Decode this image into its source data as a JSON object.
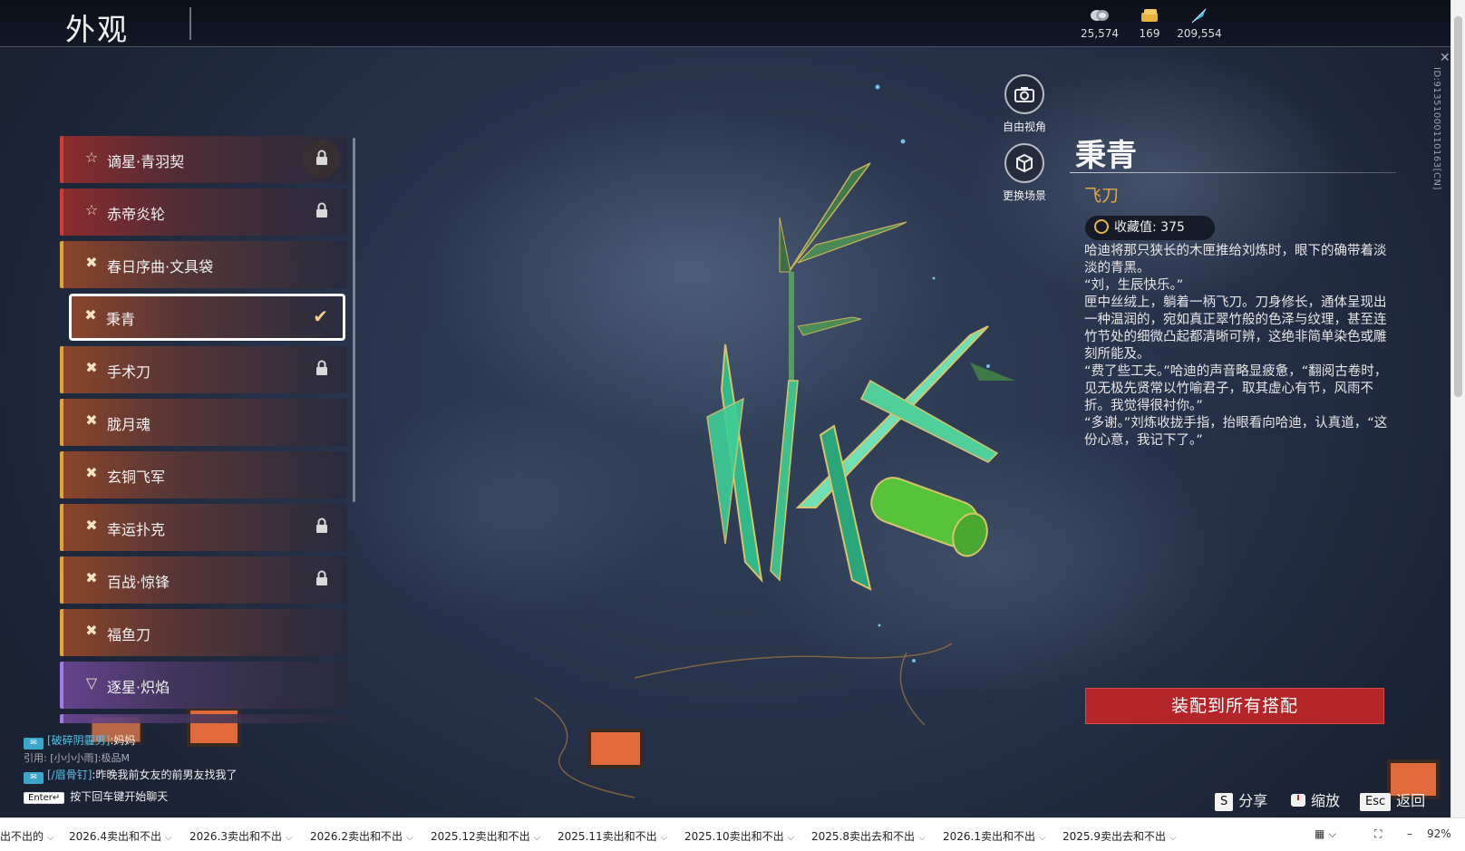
{
  "page": {
    "title": "外观",
    "player_id": "ID:91351000110163[CN]"
  },
  "currencies": [
    {
      "icon": "coin-stack-icon",
      "value": "25,574"
    },
    {
      "icon": "ticket-icon",
      "value": "169"
    },
    {
      "icon": "feather-icon",
      "value": "209,554"
    }
  ],
  "items": [
    {
      "label": "谪星·青羽契",
      "rarity": "red",
      "icon": "star-icon",
      "locked": true
    },
    {
      "label": "赤帝炎轮",
      "rarity": "red",
      "icon": "star-icon",
      "locked": true
    },
    {
      "label": "春日序曲·文具袋",
      "rarity": "gold",
      "icon": "cross-blades-icon",
      "locked": false
    },
    {
      "label": "秉青",
      "rarity": "gold",
      "icon": "cross-blades-icon",
      "locked": false,
      "selected": true
    },
    {
      "label": "手术刀",
      "rarity": "gold",
      "icon": "cross-blades-icon",
      "locked": true
    },
    {
      "label": "胧月魂",
      "rarity": "gold",
      "icon": "cross-blades-icon",
      "locked": false
    },
    {
      "label": "玄铜飞军",
      "rarity": "gold",
      "icon": "cross-blades-icon",
      "locked": false
    },
    {
      "label": "幸运扑克",
      "rarity": "gold",
      "icon": "cross-blades-icon",
      "locked": true
    },
    {
      "label": "百战·惊锋",
      "rarity": "gold",
      "icon": "cross-blades-icon",
      "locked": true
    },
    {
      "label": "福鱼刀",
      "rarity": "gold",
      "icon": "cross-blades-icon",
      "locked": false
    },
    {
      "label": "逐星·炽焰",
      "rarity": "purple",
      "icon": "chevron-icon",
      "locked": false
    }
  ],
  "camera": {
    "free_view": "自由视角",
    "change_scene": "更换场景"
  },
  "detail": {
    "name": "秉青",
    "type": "飞刀",
    "collection_label": "收藏值:",
    "collection_value": "375",
    "story": "哈迪将那只狭长的木匣推给刘炼时，眼下的确带着淡淡的青黑。\n“刘，生辰快乐。”\n匣中丝绒上，躺着一柄飞刀。刀身修长，通体呈现出一种温润的，宛如真正翠竹般的色泽与纹理，甚至连竹节处的细微凸起都清晰可辨，这绝非简单染色或雕刻所能及。\n“费了些工夫。”哈迪的声音略显疲惫，“翻阅古卷时，见无极先贤常以竹喻君子，取其虚心有节，风雨不折。我觉得很衬你。”\n“多谢。”刘炼收拢手指，抬眼看向哈迪，认真道，“这份心意，我记下了。”",
    "equip_button": "装配到所有搭配"
  },
  "chat": {
    "line1_channel": "[破碎阴霾男]",
    "line1_text": ":妈妈",
    "quote": "引用: [小小小雨]:极品M",
    "line2_channel": "[/眉骨钉]",
    "line2_text": ":昨晚我前女友的前男友找我了",
    "enter_key": "Enter↵",
    "enter_hint": "按下回车键开始聊天"
  },
  "hints": {
    "share_key": "S",
    "share": "分享",
    "zoom": "缩放",
    "esc_key": "Esc",
    "back": "返回"
  },
  "sheet_tabs": [
    "出不出的",
    "2026.4卖出和不出",
    "2026.3卖出和不出",
    "2026.2卖出和不出",
    "2025.12卖出和不出",
    "2025.11卖出和不出",
    "2025.10卖出和不出",
    "2025.8卖出去和不出",
    "2026.1卖出和不出",
    "2025.9卖出去和不出"
  ],
  "zoom_level": "92%",
  "colors": {
    "accent_gold": "#e1a33c",
    "rarity_red": "#d23a36",
    "rarity_purple": "#a07ae6",
    "equip_button": "#b4252a"
  }
}
